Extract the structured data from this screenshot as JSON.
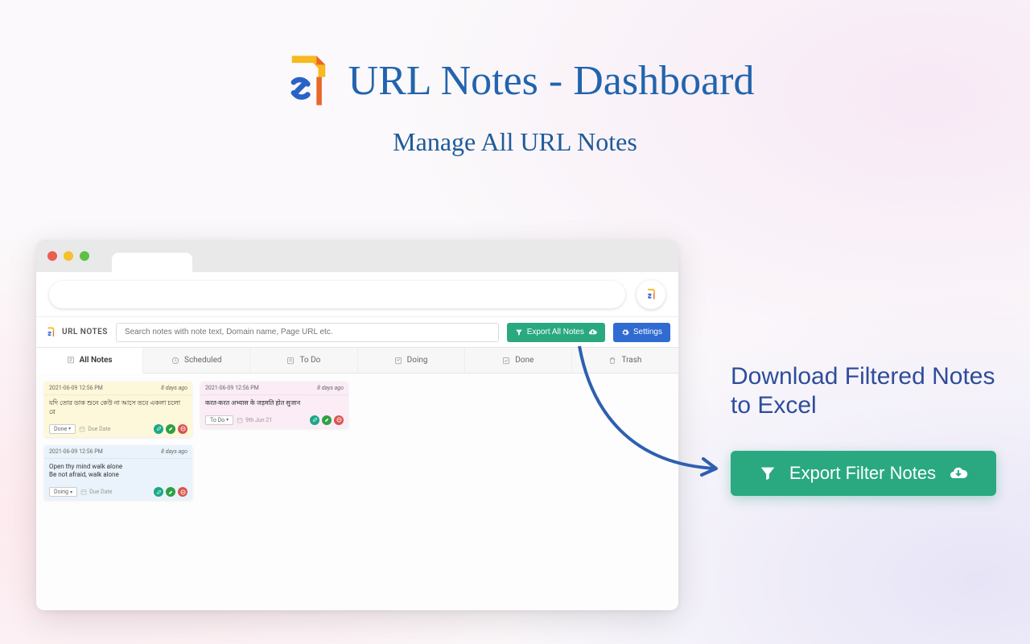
{
  "hero": {
    "title": "URL Notes - Dashboard",
    "subtitle": "Manage All URL Notes"
  },
  "dashboard": {
    "brand": "URL NOTES",
    "search_placeholder": "Search notes with note text, Domain name, Page URL etc.",
    "export_all_label": "Export All Notes",
    "settings_label": "Settings"
  },
  "tabs": {
    "all": "All Notes",
    "scheduled": "Scheduled",
    "todo": "To Do",
    "doing": "Doing",
    "done": "Done",
    "trash": "Trash"
  },
  "notes": {
    "card1": {
      "timestamp": "2021-06-09 12:56 PM",
      "age": "8 days ago",
      "body": "যদি তোর ডাক শুনে কেউ না আসে তবে একলা চলো রে",
      "status": "Done",
      "due": "Due Date"
    },
    "card2": {
      "timestamp": "2021-06-09 12:56 PM",
      "age": "8 days ago",
      "body": "Open thy mind walk alone\nBe not afraid, walk alone",
      "status": "Doing",
      "due": "Due Date"
    },
    "card3": {
      "timestamp": "2021-06-09 12:56 PM",
      "age": "8 days ago",
      "body": "करत-करत अभ्यास के जड़मति होत सुजान",
      "status": "To Do",
      "due": "9th Jun 21"
    }
  },
  "callout": {
    "text": "Download Filtered Notes to Excel",
    "button": "Export Filter Notes"
  }
}
